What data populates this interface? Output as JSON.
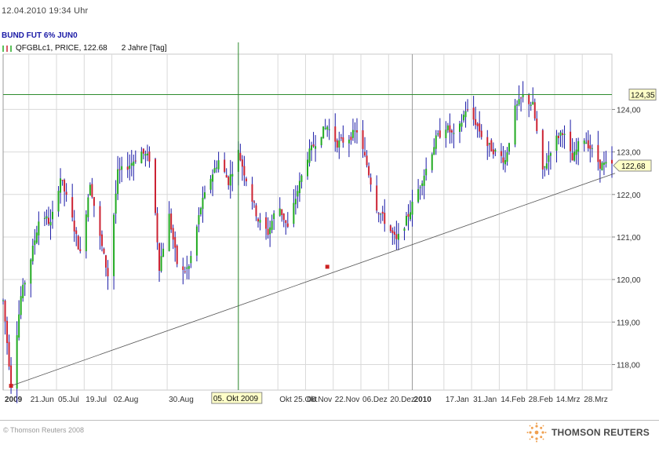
{
  "header": {
    "datetime": "12.04.2010  19:34 Uhr",
    "instrument": "BUND FUT 6% JUN0",
    "series_label": "QFGBLc1, PRICE, 122.68",
    "period": "2 Jahre [Tag]"
  },
  "footer": {
    "copyright": "© Thomson Reuters 2008",
    "brand": "THOMSON REUTERS"
  },
  "colors": {
    "up": "#22aa22",
    "down": "#cc2233",
    "wick": "#1a1aa6",
    "grid": "#d9d9d9",
    "marker_line": "#2e8b2e",
    "trendline": "#555555",
    "highlight_box": "#ffffc8"
  },
  "chart_data": {
    "type": "ohlc",
    "title": "BUND FUT 6% JUN0",
    "series_name": "QFGBLc1",
    "last_value": 122.68,
    "ylim": [
      117.4,
      125.3
    ],
    "ytick_labels": [
      "118,00",
      "119,00",
      "120,00",
      "121,00",
      "122,00",
      "123,00",
      "124,00"
    ],
    "yticks": [
      118,
      119,
      120,
      121,
      122,
      123,
      124
    ],
    "xlim": [
      "2009-06-08",
      "2010-04-12"
    ],
    "xticks": [
      {
        "date": "2009-06-08",
        "label": "2009",
        "bold": true
      },
      {
        "date": "2009-06-21",
        "label": "21.Jun"
      },
      {
        "date": "2009-07-05",
        "label": "05.Jul"
      },
      {
        "date": "2009-07-19",
        "label": "19.Jul"
      },
      {
        "date": "2009-08-02",
        "label": "02.Aug"
      },
      {
        "date": "2009-08-30",
        "label": "30.Aug"
      },
      {
        "date": "2009-10-05",
        "label": "05. Okt 2009",
        "highlight": true
      },
      {
        "date": "2009-10-25",
        "label": "Okt 25.Okt"
      },
      {
        "date": "2009-11-08",
        "label": "08.Nov"
      },
      {
        "date": "2009-11-22",
        "label": "22.Nov"
      },
      {
        "date": "2009-12-06",
        "label": "06.Dez"
      },
      {
        "date": "2009-12-20",
        "label": "20.Dez"
      },
      {
        "date": "2010-01-01",
        "label": "2010",
        "bold": true
      },
      {
        "date": "2010-01-17",
        "label": "17.Jan"
      },
      {
        "date": "2010-01-31",
        "label": "31.Jan"
      },
      {
        "date": "2010-02-14",
        "label": "14.Feb"
      },
      {
        "date": "2010-02-28",
        "label": "28.Feb"
      },
      {
        "date": "2010-03-14",
        "label": "14.Mrz"
      },
      {
        "date": "2010-03-28",
        "label": "28.Mrz"
      }
    ],
    "horizontal_line": {
      "value": 124.35,
      "label": "124,35"
    },
    "vertical_marker": {
      "date": "2009-10-05",
      "label": "05. Okt 2009"
    },
    "separator_dates": [
      "2009-06-08",
      "2010-01-01"
    ],
    "trendline": {
      "start": {
        "date": "2009-06-12",
        "value": 117.5
      },
      "end": {
        "date": "2010-04-12",
        "value": 122.5
      },
      "anchor": {
        "date": "2009-11-19",
        "value": 120.3
      }
    },
    "last_label": "122,68",
    "closes": [
      {
        "date": "2009-06-08",
        "close": 119.5
      },
      {
        "date": "2009-06-12",
        "close": 117.55
      },
      {
        "date": "2009-06-17",
        "close": 119.6
      },
      {
        "date": "2009-06-22",
        "close": 120.5
      },
      {
        "date": "2009-06-27",
        "close": 121.6
      },
      {
        "date": "2009-07-02",
        "close": 121.3
      },
      {
        "date": "2009-07-07",
        "close": 122.4
      },
      {
        "date": "2009-07-12",
        "close": 121.6
      },
      {
        "date": "2009-07-17",
        "close": 120.6
      },
      {
        "date": "2009-07-22",
        "close": 122.3
      },
      {
        "date": "2009-07-26",
        "close": 121.2
      },
      {
        "date": "2009-07-31",
        "close": 120.1
      },
      {
        "date": "2009-08-05",
        "close": 122.5
      },
      {
        "date": "2009-08-11",
        "close": 122.7
      },
      {
        "date": "2009-08-17",
        "close": 123.0
      },
      {
        "date": "2009-08-22",
        "close": 122.8
      },
      {
        "date": "2009-08-26",
        "close": 120.3
      },
      {
        "date": "2009-08-31",
        "close": 121.5
      },
      {
        "date": "2009-09-05",
        "close": 120.1
      },
      {
        "date": "2009-09-10",
        "close": 120.3
      },
      {
        "date": "2009-09-16",
        "close": 121.7
      },
      {
        "date": "2009-09-21",
        "close": 122.4
      },
      {
        "date": "2009-09-25",
        "close": 122.8
      },
      {
        "date": "2009-09-30",
        "close": 122.3
      },
      {
        "date": "2009-10-05",
        "close": 123.0
      },
      {
        "date": "2009-10-10",
        "close": 122.2
      },
      {
        "date": "2009-10-15",
        "close": 121.4
      },
      {
        "date": "2009-10-20",
        "close": 121.1
      },
      {
        "date": "2009-10-25",
        "close": 121.8
      },
      {
        "date": "2009-10-30",
        "close": 121.2
      },
      {
        "date": "2009-11-04",
        "close": 122.1
      },
      {
        "date": "2009-11-09",
        "close": 122.9
      },
      {
        "date": "2009-11-15",
        "close": 123.4
      },
      {
        "date": "2009-11-19",
        "close": 123.6
      },
      {
        "date": "2009-11-24",
        "close": 123.2
      },
      {
        "date": "2009-11-29",
        "close": 123.3
      },
      {
        "date": "2009-12-04",
        "close": 123.5
      },
      {
        "date": "2009-12-09",
        "close": 122.7
      },
      {
        "date": "2009-12-14",
        "close": 121.7
      },
      {
        "date": "2009-12-19",
        "close": 121.3
      },
      {
        "date": "2009-12-24",
        "close": 120.9
      },
      {
        "date": "2009-12-29",
        "close": 121.4
      },
      {
        "date": "2010-01-03",
        "close": 122.0
      },
      {
        "date": "2010-01-08",
        "close": 122.6
      },
      {
        "date": "2010-01-13",
        "close": 123.3
      },
      {
        "date": "2010-01-18",
        "close": 123.6
      },
      {
        "date": "2010-01-23",
        "close": 123.3
      },
      {
        "date": "2010-01-28",
        "close": 124.0
      },
      {
        "date": "2010-02-02",
        "close": 123.7
      },
      {
        "date": "2010-02-07",
        "close": 123.2
      },
      {
        "date": "2010-02-12",
        "close": 123.0
      },
      {
        "date": "2010-02-17",
        "close": 122.8
      },
      {
        "date": "2010-02-22",
        "close": 124.0
      },
      {
        "date": "2010-02-26",
        "close": 124.3
      },
      {
        "date": "2010-03-03",
        "close": 124.1
      },
      {
        "date": "2010-03-08",
        "close": 122.5
      },
      {
        "date": "2010-03-13",
        "close": 123.2
      },
      {
        "date": "2010-03-18",
        "close": 123.5
      },
      {
        "date": "2010-03-23",
        "close": 122.8
      },
      {
        "date": "2010-03-28",
        "close": 123.4
      },
      {
        "date": "2010-04-01",
        "close": 123.1
      },
      {
        "date": "2010-04-06",
        "close": 122.7
      },
      {
        "date": "2010-04-12",
        "close": 122.68
      }
    ]
  }
}
